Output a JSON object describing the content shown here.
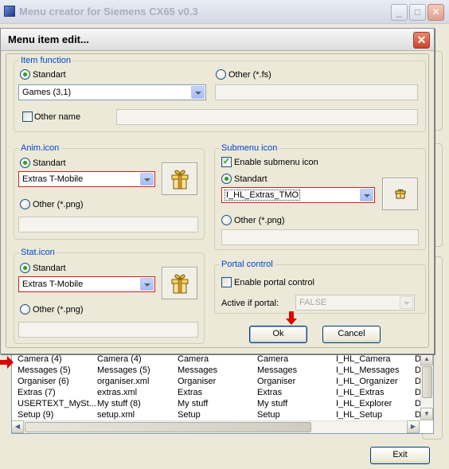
{
  "main_window": {
    "title": "Menu creator for Siemens CX65 v0.3",
    "exit_label": "Exit",
    "list_columns": 6,
    "list_rows": [
      [
        "Camera (4)",
        "Camera (4)",
        "Camera",
        "Camera",
        "I_HL_Camera",
        "D"
      ],
      [
        "Messages (5)",
        "Messages (5)",
        "Messages",
        "Messages",
        "I_HL_Messages",
        "D"
      ],
      [
        "Organiser (6)",
        "organiser.xml",
        "Organiser",
        "Organiser",
        "I_HL_Organizer",
        "D"
      ],
      [
        "Extras (7)",
        "extras.xml",
        "Extras",
        "Extras",
        "I_HL_Extras",
        "D"
      ],
      [
        "USERTEXT_MySt...",
        "My stuff (8)",
        "My stuff",
        "My stuff",
        "I_HL_Explorer",
        "D"
      ],
      [
        "Setup (9)",
        "setup.xml",
        "Setup",
        "Setup",
        "I_HL_Setup",
        "D"
      ]
    ]
  },
  "dialog": {
    "title": "Menu item edit...",
    "item_function": {
      "legend": "Item function",
      "standart_label": "Standart",
      "other_label": "Other  (*.fs)",
      "function_value": "Games (3,1)",
      "other_name_label": "Other name"
    },
    "anim_icon": {
      "legend": "Anim.icon",
      "standart_label": "Standart",
      "value": "Extras T-Mobile",
      "other_label": "Other  (*.png)"
    },
    "stat_icon": {
      "legend": "Stat.icon",
      "standart_label": "Standart",
      "value": "Extras T-Mobile",
      "other_label": "Other  (*.png)"
    },
    "submenu_icon": {
      "legend": "Submenu icon",
      "enable_label": "Enable submenu icon",
      "standart_label": "Standart",
      "value": "I_HL_Extras_TMO",
      "other_label": "Other  (*.png)"
    },
    "portal_control": {
      "legend": "Portal control",
      "enable_label": "Enable portal control",
      "active_label": "Active if portal:",
      "active_value": "FALSE"
    },
    "ok_label": "Ok",
    "cancel_label": "Cancel"
  },
  "colors": {
    "legend": "#0046d5",
    "highlight_border": "#d21e1e",
    "annotation_arrow": "#e00000"
  }
}
